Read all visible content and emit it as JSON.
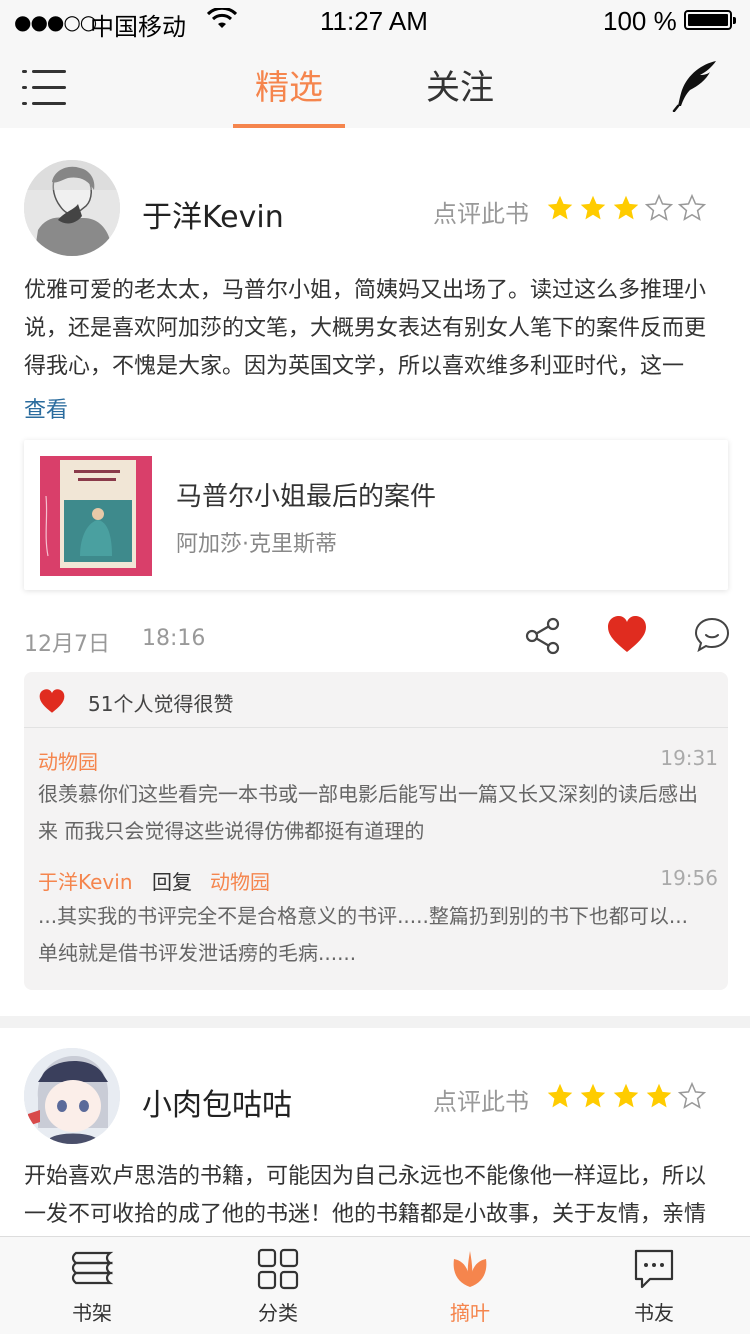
{
  "status_bar": {
    "signal": "●●●○○",
    "carrier": "中国移动",
    "time": "11:27 AM",
    "battery": "100 %"
  },
  "nav": {
    "tabs": [
      {
        "label": "精选",
        "active": true
      },
      {
        "label": "关注",
        "active": false
      }
    ],
    "accent_color": "#f5854d"
  },
  "posts": [
    {
      "username": "于洋Kevin",
      "rate_label": "点评此书",
      "rating": 3,
      "rating_max": 5,
      "text": "优雅可爱的老太太，马普尔小姐，简姨妈又出场了。读过这么多推理小说，还是喜欢阿加莎的文笔，大概男女表达有别女人笔下的案件反而更得我心，不愧是大家。因为英国文学，所以喜欢维多利亚时代，这一",
      "more": "查看",
      "book": {
        "title": "马普尔小姐最后的案件",
        "author": "阿加莎·克里斯蒂"
      },
      "date": "12月7日",
      "time": "18:16",
      "likes_text": "51个人觉得很赞",
      "comments": [
        {
          "user": "动物园",
          "time": "19:31",
          "text": "很羡慕你们这些看完一本书或一部电影后能写出一篇又长又深刻的读后感出来 而我只会觉得这些说得仿佛都挺有道理的"
        },
        {
          "user": "于洋Kevin",
          "reply_word": "回复",
          "reply_to": "动物园",
          "time": "19:56",
          "text": "...其实我的书评完全不是合格意义的书评.....整篇扔到别的书下也都可以...单纯就是借书评发泄话痨的毛病......"
        }
      ]
    },
    {
      "username": "小肉包咕咕",
      "rate_label": "点评此书",
      "rating": 4,
      "rating_max": 5,
      "text": "开始喜欢卢思浩的书籍，可能因为自己永远也不能像他一样逗比，所以一发不可收拾的成了他的书迷！他的书籍都是小故事，关于友情，亲情"
    }
  ],
  "tabbar": [
    {
      "label": "书架",
      "icon": "bookshelf-icon",
      "active": false
    },
    {
      "label": "分类",
      "icon": "category-grid-icon",
      "active": false
    },
    {
      "label": "摘叶",
      "icon": "leaf-icon",
      "active": true
    },
    {
      "label": "书友",
      "icon": "chat-icon",
      "active": false
    }
  ]
}
